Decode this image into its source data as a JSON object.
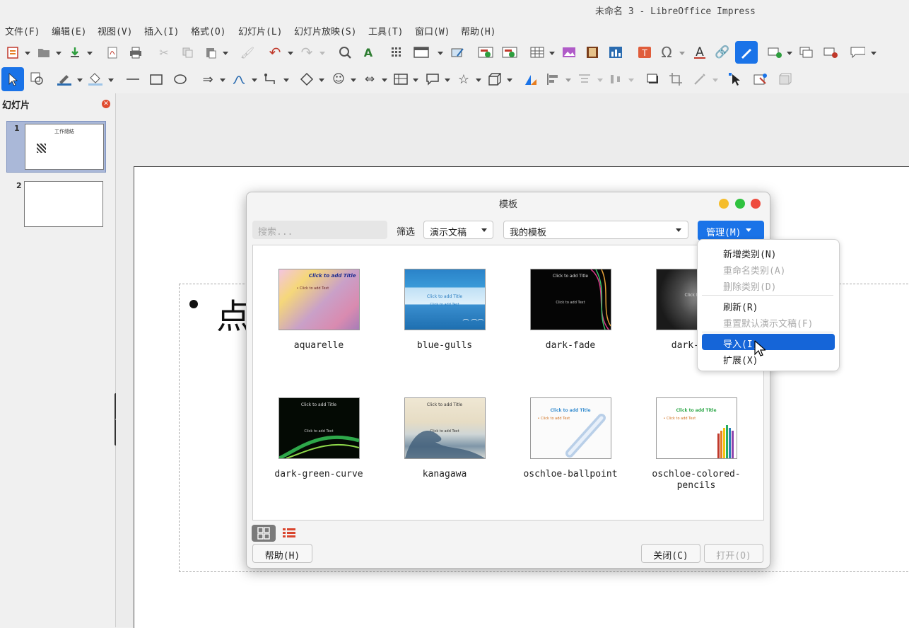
{
  "window": {
    "title": "未命名 3 - LibreOffice Impress"
  },
  "menubar": [
    "文件(F)",
    "编辑(E)",
    "视图(V)",
    "插入(I)",
    "格式(O)",
    "幻灯片(L)",
    "幻灯片放映(S)",
    "工具(T)",
    "窗口(W)",
    "帮助(H)"
  ],
  "sidebar": {
    "title": "幻灯片",
    "slides": [
      {
        "number": "1",
        "title": "工作總結"
      },
      {
        "number": "2",
        "title": ""
      }
    ]
  },
  "slide": {
    "bullet_text": "点"
  },
  "dialog": {
    "title": "模板",
    "search_placeholder": "搜索...",
    "filter_label": "筛选",
    "filter_value": "演示文稿",
    "category_value": "我的模板",
    "manage_button": "管理(M)",
    "help_button": "帮助(H)",
    "close_button": "关闭(C)",
    "open_button": "打开(O)",
    "templates": [
      {
        "name": "aquarelle",
        "thumb_title": "Click to add Title",
        "thumb_text": "• Click to add Text"
      },
      {
        "name": "blue-gulls",
        "thumb_title": "Click to add Title",
        "thumb_text": "Click to add Text"
      },
      {
        "name": "dark-fade",
        "thumb_title": "Click to add Title",
        "thumb_text": "Click to add Text"
      },
      {
        "name": "dark-gray",
        "thumb_title": "Click to add Title",
        "thumb_text": ""
      },
      {
        "name": "dark-green-curve",
        "thumb_title": "Click to add Title",
        "thumb_text": "Click to add Text"
      },
      {
        "name": "kanagawa",
        "thumb_title": "Click to add Title",
        "thumb_text": "Click to add Text"
      },
      {
        "name": "oschloe-ballpoint",
        "thumb_title": "Click to add Title",
        "thumb_text": "• Click to add Text"
      },
      {
        "name": "oschloe-colored-pencils",
        "thumb_title": "Click to add Title",
        "thumb_text": "• Click to add Text"
      }
    ]
  },
  "manage_menu": {
    "items": [
      {
        "label": "新增类别(N)",
        "enabled": true
      },
      {
        "label": "重命名类别(A)",
        "enabled": false
      },
      {
        "label": "删除类别(D)",
        "enabled": false
      },
      {
        "label": "刷新(R)",
        "enabled": true
      },
      {
        "label": "重置默认演示文稿(F)",
        "enabled": false
      },
      {
        "label": "导入(I)",
        "enabled": true,
        "highlighted": true
      },
      {
        "label": "扩展(X)",
        "enabled": true
      }
    ]
  },
  "colors": {
    "accent": "#1a73e8",
    "highlight": "#1565d8",
    "selection": "#aab8d8"
  }
}
